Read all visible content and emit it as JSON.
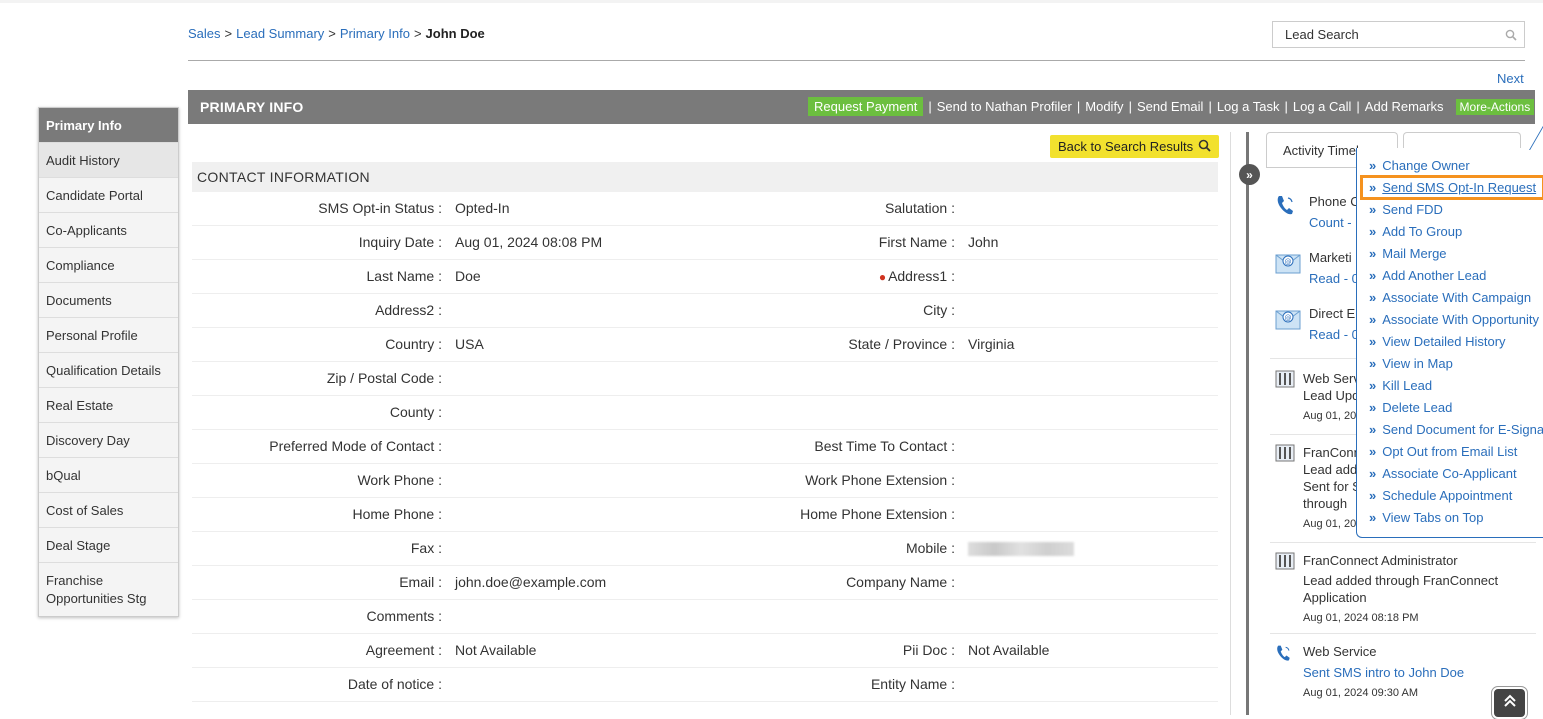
{
  "breadcrumb": {
    "items": [
      "Sales",
      "Lead Summary",
      "Primary Info"
    ],
    "current": "John Doe",
    "separator": ">"
  },
  "search": {
    "placeholder": "Lead Search"
  },
  "nav": {
    "next_label": "Next"
  },
  "sidebar": {
    "header": "Primary Info",
    "items": [
      {
        "label": "Audit History"
      },
      {
        "label": "Candidate Portal"
      },
      {
        "label": "Co-Applicants"
      },
      {
        "label": "Compliance"
      },
      {
        "label": "Documents"
      },
      {
        "label": "Personal Profile"
      },
      {
        "label": "Qualification Details"
      },
      {
        "label": "Real Estate"
      },
      {
        "label": "Discovery Day"
      },
      {
        "label": "bQual"
      },
      {
        "label": "Cost of Sales"
      },
      {
        "label": "Deal Stage"
      },
      {
        "label": "Franchise Opportunities Stg"
      }
    ]
  },
  "header": {
    "title": "PRIMARY INFO",
    "request_payment": "Request Payment",
    "actions": [
      "Send to Nathan Profiler",
      "Modify",
      "Send Email",
      "Log a Task",
      "Log a Call",
      "Add Remarks"
    ],
    "more_actions": "More-Actions"
  },
  "back_button": {
    "label": "Back to Search Results"
  },
  "contact": {
    "section_title": "CONTACT INFORMATION",
    "rows": [
      {
        "l1": "SMS Opt-in Status :",
        "v1": "Opted-In",
        "l2": "Salutation :",
        "v2": ""
      },
      {
        "l1": "Inquiry Date :",
        "v1": "Aug 01, 2024 08:08 PM",
        "l2": "First Name :",
        "v2": "John"
      },
      {
        "l1": "Last Name :",
        "v1": "Doe",
        "l2": "Address1 :",
        "v2": ""
      },
      {
        "l1": "Address2 :",
        "v1": "",
        "l2": "City :",
        "v2": ""
      },
      {
        "l1": "Country :",
        "v1": "USA",
        "l2": "State / Province :",
        "v2": "Virginia"
      },
      {
        "l1": "Zip / Postal Code :",
        "v1": "",
        "l2": "",
        "v2": ""
      },
      {
        "l1": "County :",
        "v1": "",
        "l2": "",
        "v2": ""
      },
      {
        "l1": "Preferred Mode of Contact :",
        "v1": "",
        "l2": "Best Time To Contact :",
        "v2": ""
      },
      {
        "l1": "Work Phone :",
        "v1": "",
        "l2": "Work Phone Extension :",
        "v2": ""
      },
      {
        "l1": "Home Phone :",
        "v1": "",
        "l2": "Home Phone Extension :",
        "v2": ""
      },
      {
        "l1": "Fax :",
        "v1": "",
        "l2": "Mobile :",
        "v2": ""
      },
      {
        "l1": "Email :",
        "v1": "john.doe@example.com",
        "l2": "Company Name :",
        "v2": ""
      },
      {
        "l1": "Comments :",
        "v1": "",
        "l2": "",
        "v2": ""
      },
      {
        "l1": "Agreement :",
        "v1": "Not Available",
        "l2": "Pii Doc :",
        "v2": "Not Available"
      },
      {
        "l1": "Date of notice :",
        "v1": "",
        "l2": "Entity Name :",
        "v2": ""
      }
    ]
  },
  "timeline": {
    "tab_label": "Activity Timel",
    "items": [
      {
        "icon": "phone-icon",
        "line1": "Phone C",
        "line2": "Count -"
      },
      {
        "icon": "email-icon",
        "line1": "Marketi",
        "line2": "Read - 0"
      },
      {
        "icon": "email-icon",
        "line1": "Direct E",
        "line2": "Read - 0"
      },
      {
        "icon": "document-icon",
        "line1": "Web Servi",
        "line2": "Lead Upd",
        "date": "Aug 01, 20"
      },
      {
        "icon": "document-icon",
        "line1": "FranConn",
        "line2": "Lead add",
        "line3": "Sent for S",
        "line4": "through",
        "date": "Aug 01, 20"
      },
      {
        "icon": "document-icon",
        "line1": "FranConnect Administrator",
        "line2": "Lead added through FranConnect Application",
        "date": "Aug 01, 2024 08:18 PM"
      },
      {
        "icon": "phone-icon",
        "line1": "Web Service",
        "line2": "Sent SMS intro to John Doe",
        "date": "Aug 01, 2024 09:30 AM"
      }
    ]
  },
  "more_actions_menu": {
    "items": [
      "Change Owner",
      "Send SMS Opt-In Request",
      "Send FDD",
      "Add To Group",
      "Mail Merge",
      "Add Another Lead",
      "Associate With Campaign",
      "Associate With Opportunity",
      "View Detailed History",
      "View in Map",
      "Kill Lead",
      "Delete Lead",
      "Send Document for E-Signa",
      "Opt Out from Email List",
      "Associate Co-Applicant",
      "Schedule Appointment",
      "View Tabs on Top"
    ],
    "highlighted": "Send SMS Opt-In Request"
  },
  "colors": {
    "accent": "#2a6ebb",
    "header_bg": "#7a7a7a",
    "green": "#6cbf3f",
    "highlight": "#f5921e",
    "yellow": "#f2e12e"
  }
}
